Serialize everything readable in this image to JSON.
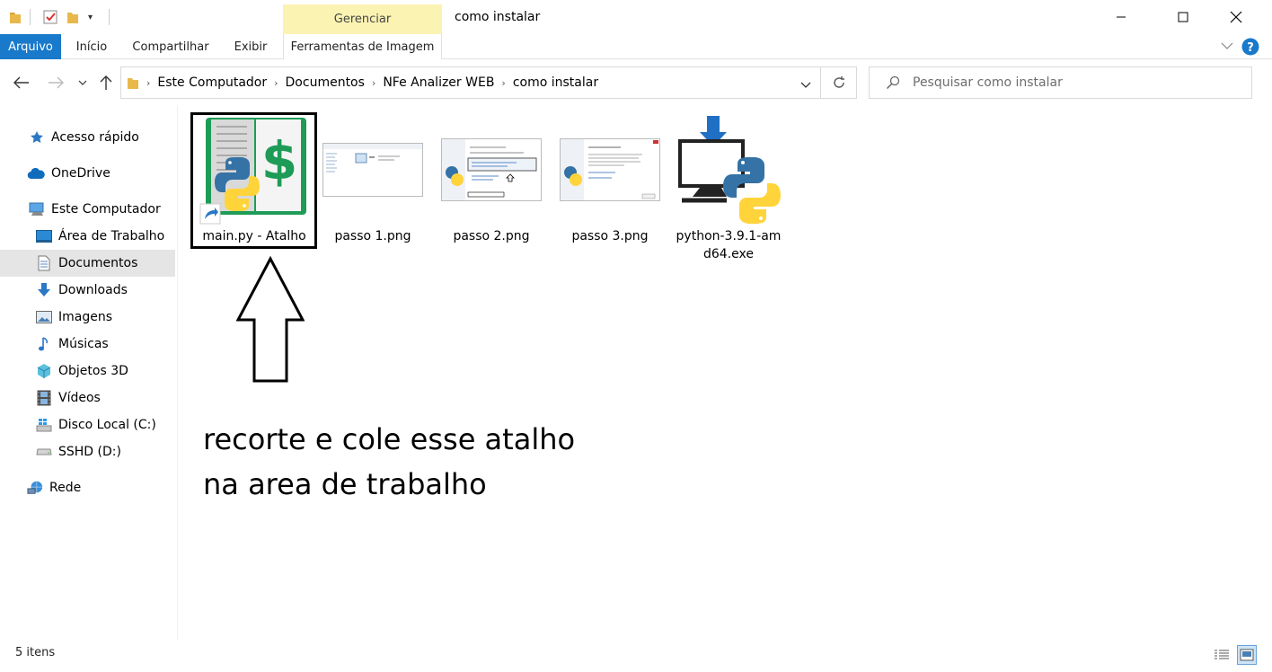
{
  "window": {
    "title": "como instalar",
    "context_group_label": "Gerenciar",
    "minimize_symbol": "—",
    "maximize_symbol": "☐",
    "close_symbol": "✕"
  },
  "ribbon": {
    "tabs": [
      {
        "label": "Arquivo"
      },
      {
        "label": "Início"
      },
      {
        "label": "Compartilhar"
      },
      {
        "label": "Exibir"
      },
      {
        "label": "Ferramentas de Imagem"
      }
    ]
  },
  "address": {
    "breadcrumbs": [
      "Este Computador",
      "Documentos",
      "NFe Analizer WEB",
      "como instalar"
    ],
    "search_placeholder": "Pesquisar como instalar"
  },
  "sidebar": {
    "items": [
      {
        "label": "Acesso rápido",
        "icon": "star-icon"
      },
      {
        "label": "OneDrive",
        "icon": "cloud-icon"
      },
      {
        "label": "Este Computador",
        "icon": "computer-icon"
      },
      {
        "label": "Área de Trabalho",
        "icon": "desktop-icon"
      },
      {
        "label": "Documentos",
        "icon": "document-icon",
        "selected": true
      },
      {
        "label": "Downloads",
        "icon": "download-icon"
      },
      {
        "label": "Imagens",
        "icon": "image-icon"
      },
      {
        "label": "Músicas",
        "icon": "music-icon"
      },
      {
        "label": "Objetos 3D",
        "icon": "cube-icon"
      },
      {
        "label": "Vídeos",
        "icon": "film-icon"
      },
      {
        "label": "Disco Local (C:)",
        "icon": "windows-drive-icon"
      },
      {
        "label": "SSHD (D:)",
        "icon": "drive-icon"
      },
      {
        "label": "Rede",
        "icon": "network-icon"
      }
    ]
  },
  "files": [
    {
      "name": "main.py - Atalho",
      "icon": "python-dollar-shortcut-icon"
    },
    {
      "name": "passo 1.png",
      "icon": "screenshot-thumbnail"
    },
    {
      "name": "passo 2.png",
      "icon": "installer-screenshot-thumbnail"
    },
    {
      "name": "passo 3.png",
      "icon": "setup-success-screenshot-thumbnail"
    },
    {
      "name": "python-3.9.1-amd64.exe",
      "icon": "python-installer-icon"
    }
  ],
  "annotation": {
    "line1": "recorte e cole esse atalho",
    "line2": "na area de trabalho"
  },
  "status": {
    "item_count": "5 itens"
  },
  "colors": {
    "accent": "#1979ca",
    "context_tab": "#fbf3b2",
    "selection": "#e5e5e5",
    "python_blue": "#3572a5",
    "python_yellow": "#ffd43b",
    "book_green": "#1e9c57"
  }
}
